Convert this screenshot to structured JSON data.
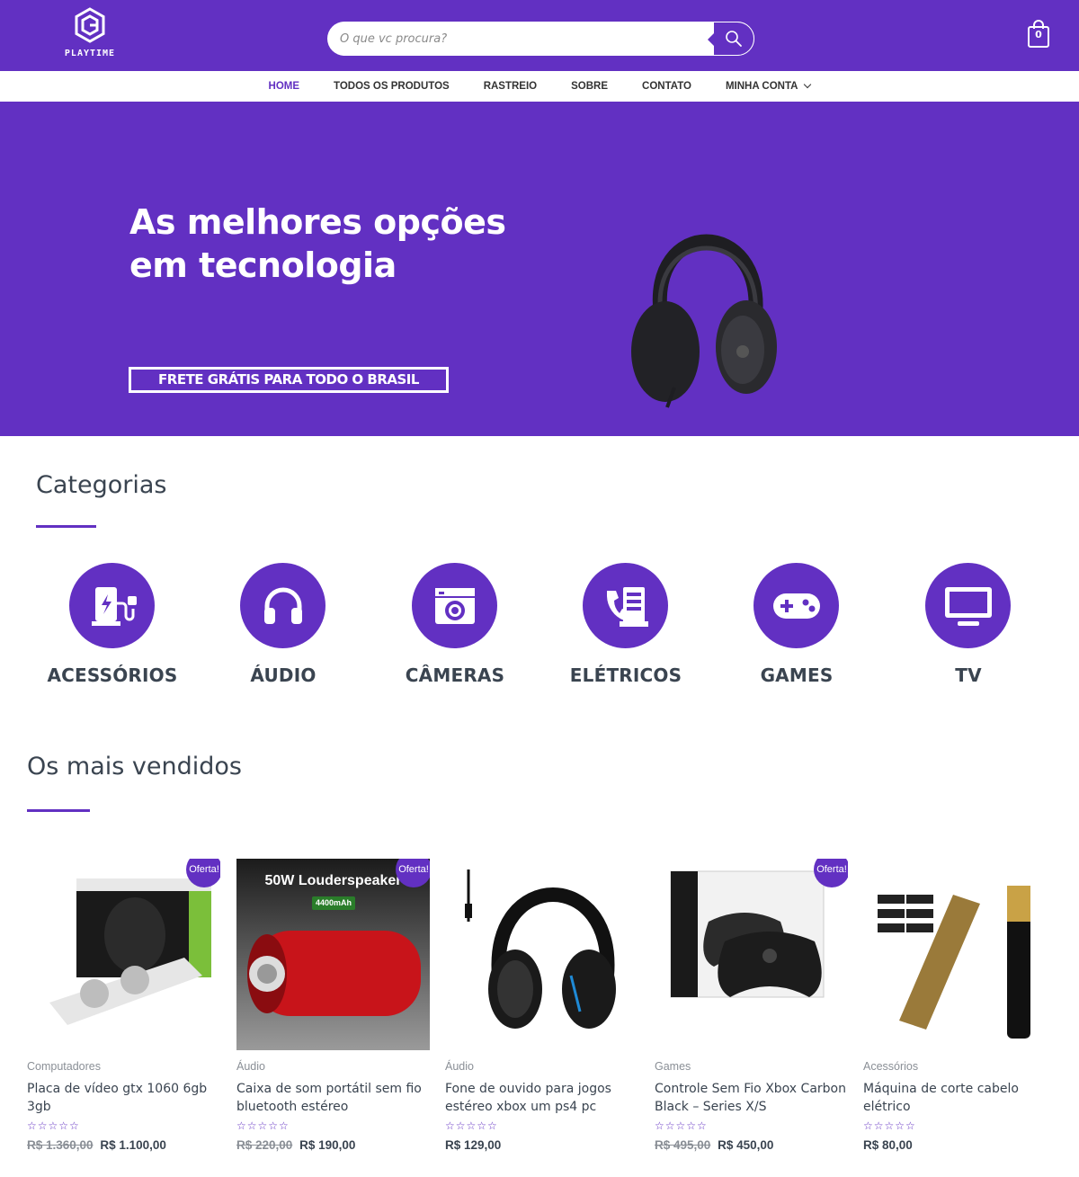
{
  "header": {
    "logo_text": "PLAYTIME",
    "search_placeholder": "O que vc procura?",
    "cart_count": "0"
  },
  "nav": {
    "items": [
      "HOME",
      "TODOS OS PRODUTOS",
      "RASTREIO",
      "SOBRE",
      "CONTATO",
      "MINHA CONTA"
    ],
    "active": "HOME"
  },
  "hero": {
    "title_line1": "As melhores opções",
    "title_line2": "em tecnologia",
    "badge": "FRETE GRÁTIS PARA TODO O BRASIL"
  },
  "categories": {
    "title": "Categorias",
    "items": [
      {
        "label": "ACESSÓRIOS",
        "icon": "charging-station-icon"
      },
      {
        "label": "ÁUDIO",
        "icon": "headphones-icon"
      },
      {
        "label": "CÂMERAS",
        "icon": "camera-icon"
      },
      {
        "label": "ELÉTRICOS",
        "icon": "phone-fax-icon"
      },
      {
        "label": "GAMES",
        "icon": "gamepad-icon"
      },
      {
        "label": "TV",
        "icon": "tv-icon"
      }
    ]
  },
  "bestsellers": {
    "title": "Os mais vendidos",
    "products": [
      {
        "category": "Computadores",
        "name": "Placa de vídeo gtx 1060 6gb 3gb",
        "old_price": "R$ 1.360,00",
        "price": "R$ 1.100,00",
        "sale": "Oferta!"
      },
      {
        "category": "Áudio",
        "name": "Caixa de som portátil sem fio bluetooth estéreo",
        "old_price": "R$ 220,00",
        "price": "R$ 190,00",
        "sale": "Oferta!",
        "image_caption": "50W Louderspeaker",
        "image_badge": "4400mAh"
      },
      {
        "category": "Áudio",
        "name": "Fone de ouvido para jogos estéreo xbox um ps4 pc",
        "old_price": "",
        "price": "R$ 129,00",
        "sale": ""
      },
      {
        "category": "Games",
        "name": "Controle Sem Fio Xbox Carbon Black – Series X/S",
        "old_price": "R$ 495,00",
        "price": "R$ 450,00",
        "sale": "Oferta!"
      },
      {
        "category": "Acessórios",
        "name": "Máquina de corte cabelo elétrico",
        "old_price": "",
        "price": "R$ 80,00",
        "sale": ""
      }
    ],
    "rating_stars": "☆☆☆☆☆"
  },
  "colors": {
    "brand": "#6230c2",
    "text": "#3a4450",
    "muted": "#8a8f96"
  }
}
